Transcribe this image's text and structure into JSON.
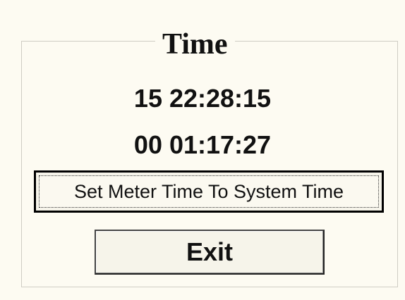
{
  "dialog": {
    "title": "Time",
    "meter_time": "15 22:28:15",
    "elapsed_time": "00 01:17:27"
  },
  "buttons": {
    "set_time_label": "Set Meter Time To System Time",
    "exit_label": "Exit"
  }
}
